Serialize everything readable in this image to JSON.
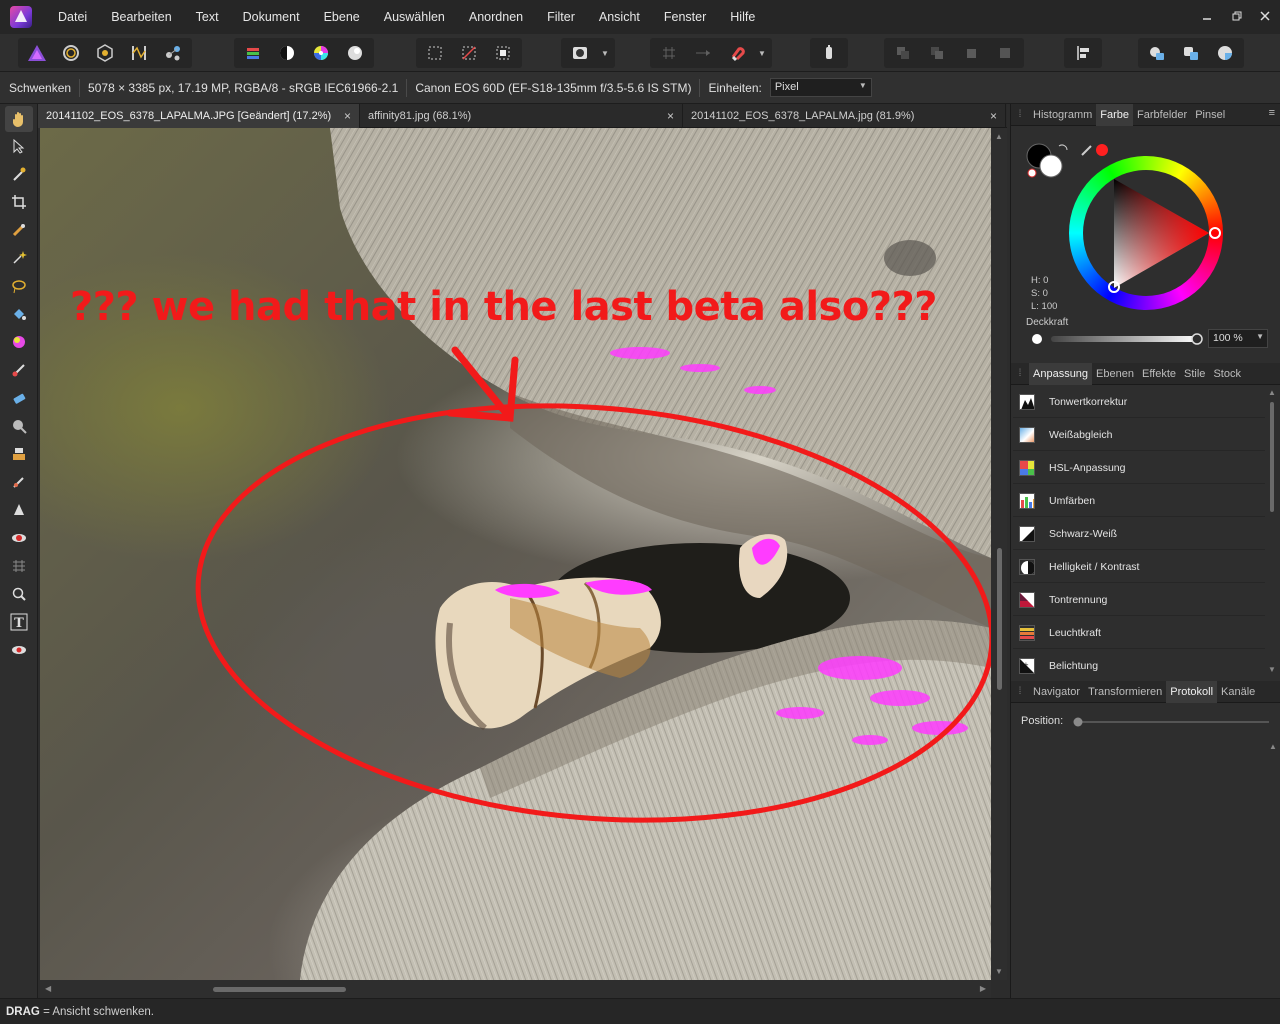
{
  "menubar": {
    "items": [
      "Datei",
      "Bearbeiten",
      "Text",
      "Dokument",
      "Ebene",
      "Auswählen",
      "Anordnen",
      "Filter",
      "Ansicht",
      "Fenster",
      "Hilfe"
    ],
    "window_controls": [
      "minimize-icon",
      "restore-icon",
      "close-icon"
    ]
  },
  "contextbar": {
    "tool_name": "Schwenken",
    "image_info": "5078 × 3385 px, 17.19 MP, RGBA/8 - sRGB IEC61966-2.1",
    "camera_info": "Canon EOS 60D (EF-S18-135mm f/3.5-5.6 IS STM)",
    "units_label": "Einheiten:",
    "units_value": "Pixel"
  },
  "doc_tabs": [
    {
      "title": "20141102_EOS_6378_LAPALMA.JPG [Geändert] (17.2%)",
      "close": "×"
    },
    {
      "title": "affinity81.jpg (68.1%)",
      "close": "×"
    },
    {
      "title": "20141102_EOS_6378_LAPALMA.jpg (81.9%)",
      "close": "×"
    }
  ],
  "canvas": {
    "annotation": "??? we had that in the last beta also???",
    "annotation_color": "#f21a1a",
    "highlight_color": "#ff3cff"
  },
  "color_panel": {
    "tabs": [
      "Histogramm",
      "Farbe",
      "Farbfelder",
      "Pinsel"
    ],
    "active_tab": "Farbe",
    "h": "H: 0",
    "s": "S: 0",
    "l": "L: 100",
    "opacity_label": "Deckkraft",
    "opacity_value": "100 %",
    "current_color": "#ff2020"
  },
  "adjust_panel": {
    "tabs": [
      "Anpassung",
      "Ebenen",
      "Effekte",
      "Stile",
      "Stock"
    ],
    "active_tab": "Anpassung",
    "items": [
      "Tonwertkorrektur",
      "Weißabgleich",
      "HSL-Anpassung",
      "Umfärben",
      "Schwarz-Weiß",
      "Helligkeit / Kontrast",
      "Tontrennung",
      "Leuchtkraft",
      "Belichtung"
    ]
  },
  "history_panel": {
    "tabs": [
      "Navigator",
      "Transformieren",
      "Protokoll",
      "Kanäle"
    ],
    "active_tab": "Protokoll",
    "position_label": "Position:"
  },
  "statusbar": {
    "key": "DRAG",
    "text": " = Ansicht schwenken."
  }
}
